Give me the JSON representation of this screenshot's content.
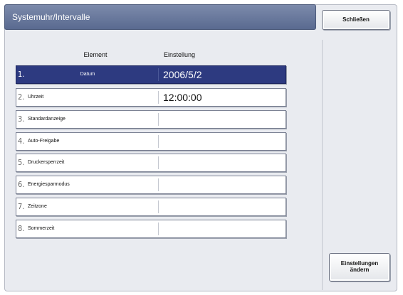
{
  "window": {
    "title": "Systemuhr/Intervalle"
  },
  "buttons": {
    "close_label": "Schließen",
    "change_settings_label": "Einstellungen ändern"
  },
  "table": {
    "headers": {
      "element": "Element",
      "setting": "Einstellung"
    },
    "rows": [
      {
        "number": "1.",
        "label": "Datum",
        "value": "2006/5/2",
        "selected": true
      },
      {
        "number": "2.",
        "label": "Uhrzeit",
        "value": "12:00:00",
        "selected": false
      },
      {
        "number": "3.",
        "label": "Standardanzeige",
        "value": "",
        "selected": false
      },
      {
        "number": "4.",
        "label": "Auto-Freigabe",
        "value": "",
        "selected": false
      },
      {
        "number": "5.",
        "label": "Druckersperrzeit",
        "value": "",
        "selected": false
      },
      {
        "number": "6.",
        "label": "Energiesparmodus",
        "value": "",
        "selected": false
      },
      {
        "number": "7.",
        "label": "Zeitzone",
        "value": "",
        "selected": false
      },
      {
        "number": "8.",
        "label": "Sommerzeit",
        "value": "",
        "selected": false
      }
    ]
  }
}
